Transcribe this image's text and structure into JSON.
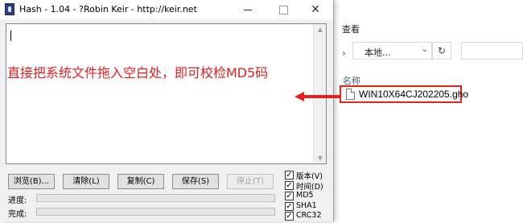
{
  "explorer": {
    "view_tab": "查看",
    "address_text": "本地...",
    "name_header": "名称",
    "file_name": "WIN10X64CJ202205.gho"
  },
  "hash_window": {
    "title": "Hash - 1.04 - ?Robin Keir - http://keir.net",
    "instruction_text": "直接把系统文件拖入空白处，即可校检MD5码",
    "buttons": {
      "browse": "浏览(B)...",
      "clear": "清除(L)",
      "copy": "复制(C)",
      "save": "保存(S)",
      "stop": "停止(T)"
    },
    "progress_label": "进度:",
    "done_label": "完成:",
    "progress_value": 0,
    "done_value": 0,
    "checkboxes": [
      {
        "label": "版本(V)",
        "checked": true
      },
      {
        "label": "时间(D)",
        "checked": true
      },
      {
        "label": "MD5",
        "checked": true
      },
      {
        "label": "SHA1",
        "checked": true
      },
      {
        "label": "CRC32",
        "checked": true
      }
    ]
  },
  "colors": {
    "annotation_red": "#e02020",
    "window_bg": "#f0f0f0"
  }
}
